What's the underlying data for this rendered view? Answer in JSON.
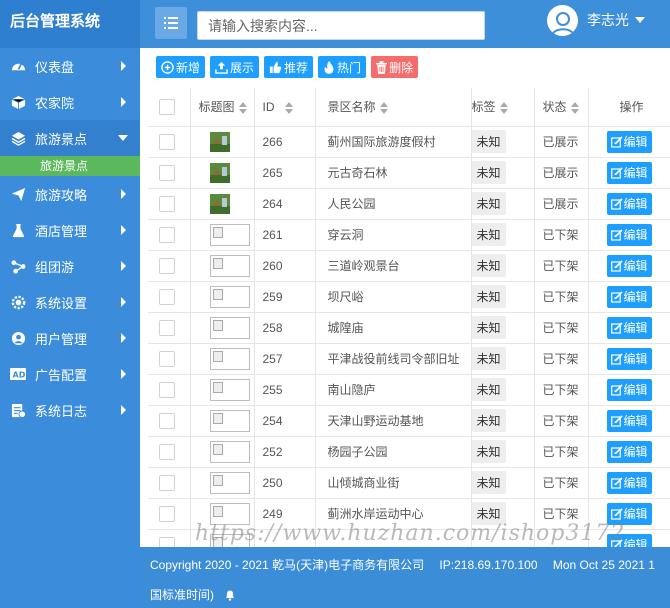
{
  "header": {
    "brand": "后台管理系统",
    "search_placeholder": "请输入搜索内容...",
    "user_name": "李志光"
  },
  "sidebar": {
    "items": [
      {
        "label": "仪表盘",
        "icon": "dashboard-icon"
      },
      {
        "label": "农家院",
        "icon": "cube-icon"
      },
      {
        "label": "旅游景点",
        "icon": "layers-icon",
        "expanded": true
      },
      {
        "label": "旅游攻略",
        "icon": "paper-plane-icon"
      },
      {
        "label": "酒店管理",
        "icon": "flask-icon"
      },
      {
        "label": "组团游",
        "icon": "share-icon"
      },
      {
        "label": "系统设置",
        "icon": "gear-icon"
      },
      {
        "label": "用户管理",
        "icon": "user-icon"
      },
      {
        "label": "广告配置",
        "icon": "ad-icon"
      },
      {
        "label": "系统日志",
        "icon": "log-icon"
      }
    ],
    "sub_item": "旅游景点"
  },
  "toolbar": {
    "add": "新增",
    "show": "展示",
    "recommend": "推荐",
    "hot": "热门",
    "delete": "删除"
  },
  "table": {
    "headers": {
      "thumb": "标题图",
      "id": "ID",
      "name": "景区名称",
      "tag": "标签",
      "status": "状态",
      "action": "操作"
    },
    "edit_label": "编辑",
    "rows": [
      {
        "id": "266",
        "name": "蓟州国际旅游度假村",
        "tag": "未知",
        "status": "已展示",
        "img": "photo"
      },
      {
        "id": "265",
        "name": "元古奇石林",
        "tag": "未知",
        "status": "已展示",
        "img": "photo"
      },
      {
        "id": "264",
        "name": "人民公园",
        "tag": "未知",
        "status": "已展示",
        "img": "photo"
      },
      {
        "id": "261",
        "name": "穿云洞",
        "tag": "未知",
        "status": "已下架",
        "img": "broken"
      },
      {
        "id": "260",
        "name": "三道岭观景台",
        "tag": "未知",
        "status": "已下架",
        "img": "broken"
      },
      {
        "id": "259",
        "name": "坝尺峪",
        "tag": "未知",
        "status": "已下架",
        "img": "broken"
      },
      {
        "id": "258",
        "name": "城隍庙",
        "tag": "未知",
        "status": "已下架",
        "img": "broken"
      },
      {
        "id": "257",
        "name": "平津战役前线司令部旧址",
        "tag": "未知",
        "status": "已下架",
        "img": "broken"
      },
      {
        "id": "255",
        "name": "南山隐庐",
        "tag": "未知",
        "status": "已下架",
        "img": "broken"
      },
      {
        "id": "254",
        "name": "天津山野运动基地",
        "tag": "未知",
        "status": "已下架",
        "img": "broken"
      },
      {
        "id": "252",
        "name": "杨园子公园",
        "tag": "未知",
        "status": "已下架",
        "img": "broken"
      },
      {
        "id": "250",
        "name": "山倾城商业街",
        "tag": "未知",
        "status": "已下架",
        "img": "broken"
      },
      {
        "id": "249",
        "name": "蓟洲水岸运动中心",
        "tag": "未知",
        "status": "已下架",
        "img": "broken"
      },
      {
        "id": "",
        "name": "",
        "tag": "",
        "status": "",
        "img": "broken"
      }
    ]
  },
  "footer": {
    "copyright": "Copyright 2020 - 2021 乾马(天津)电子商务有限公司",
    "ip": "IP:218.69.170.100",
    "date": "Mon Oct 25 2021 1",
    "tz": "国标准时间)"
  },
  "watermark": "https://www.huzhan.com/ishop3172"
}
